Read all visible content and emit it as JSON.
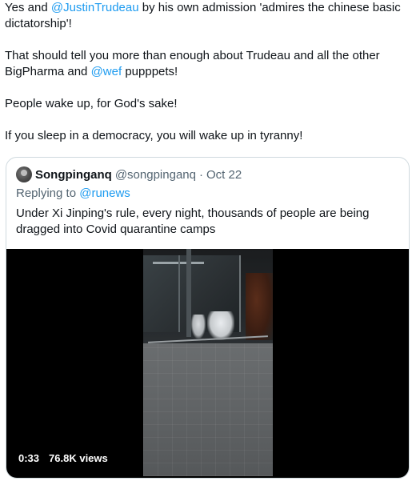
{
  "tweet": {
    "line1_prefix": "Yes and ",
    "line1_mention": "@JustinTrudeau",
    "line1_suffix": " by his own admission 'admires the chinese basic dictatorship'!",
    "line2_prefix": "That should tell you more than enough about Trudeau and all the other BigPharma and ",
    "line2_mention": "@wef",
    "line2_suffix": " pupppets!",
    "line3": "People wake up, for God's sake!",
    "line4": "If you sleep in a democracy, you will wake up in tyranny!"
  },
  "quote": {
    "display_name": "Songpinganq",
    "handle": "@songpinganq",
    "separator": "·",
    "date": "Oct 22",
    "replying_prefix": "Replying to ",
    "replying_to": "@runews",
    "text": "Under Xi Jinping's rule, every night, thousands of people are being dragged into Covid quarantine camps",
    "video": {
      "duration": "0:33",
      "views": "76.8K views"
    }
  },
  "colors": {
    "link": "#1d9bf0",
    "secondary_text": "#536471",
    "border": "#cfd9de"
  }
}
